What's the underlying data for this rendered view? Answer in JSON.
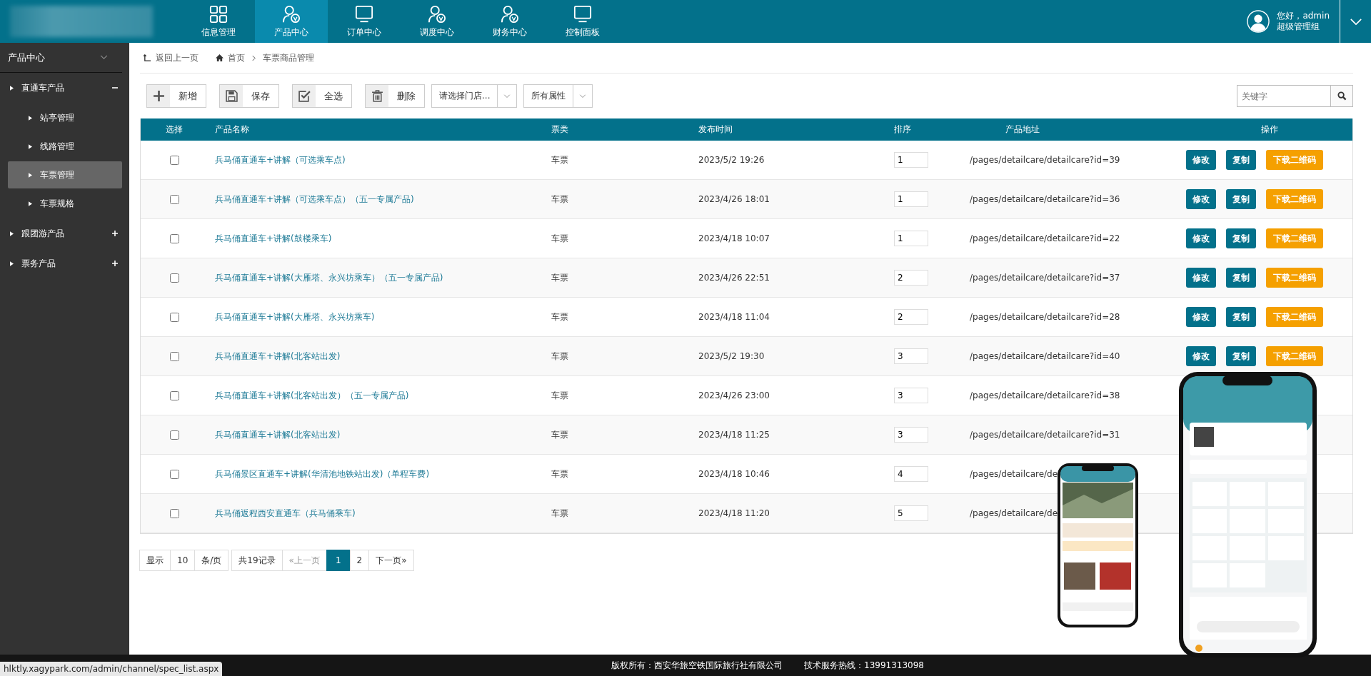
{
  "header": {
    "nav": [
      {
        "label": "信息管理",
        "selected": false
      },
      {
        "label": "产品中心",
        "selected": true
      },
      {
        "label": "订单中心",
        "selected": false
      },
      {
        "label": "调度中心",
        "selected": false
      },
      {
        "label": "财务中心",
        "selected": false
      },
      {
        "label": "控制面板",
        "selected": false
      }
    ],
    "user": {
      "greeting": "您好，admin",
      "role": "超级管理组"
    }
  },
  "sidebar": {
    "title": "产品中心",
    "groups": [
      {
        "label": "直通车产品",
        "expanded": true,
        "children": [
          {
            "label": "站亭管理",
            "selected": false
          },
          {
            "label": "线路管理",
            "selected": false
          },
          {
            "label": "车票管理",
            "selected": true
          },
          {
            "label": "车票规格",
            "selected": false
          }
        ]
      },
      {
        "label": "跟团游产品",
        "expanded": false
      },
      {
        "label": "票务产品",
        "expanded": false
      }
    ]
  },
  "breadcrumb": {
    "back": "返回上一页",
    "home": "首页",
    "current": "车票商品管理"
  },
  "toolbar": {
    "buttons": [
      "新增",
      "保存",
      "全选",
      "删除"
    ],
    "selects": [
      "请选择门店...",
      "所有属性"
    ],
    "search": {
      "placeholder": "关键字"
    }
  },
  "table": {
    "columns": [
      "选择",
      "产品名称",
      "票类",
      "发布时间",
      "排序",
      "产品地址",
      "操作"
    ],
    "rows": [
      {
        "checked": false,
        "name": "兵马俑直通车+讲解（可选乘车点)",
        "type": "车票",
        "time": "2023/5/2 19:26",
        "sort": "1",
        "url": "/pages/detailcare/detailcare?id=39",
        "actions": [
          "修改",
          "复制",
          "下载二维码"
        ]
      },
      {
        "checked": false,
        "name": "兵马俑直通车+讲解（可选乘车点）（五一专属产品)",
        "type": "车票",
        "time": "2023/4/26 18:01",
        "sort": "1",
        "url": "/pages/detailcare/detailcare?id=36",
        "actions": [
          "修改",
          "复制",
          "下载二维码"
        ]
      },
      {
        "checked": false,
        "name": "兵马俑直通车+讲解(鼓楼乘车)",
        "type": "车票",
        "time": "2023/4/18 10:07",
        "sort": "1",
        "url": "/pages/detailcare/detailcare?id=22",
        "actions": [
          "修改",
          "复制",
          "下载二维码"
        ]
      },
      {
        "checked": false,
        "name": "兵马俑直通车+讲解(大雁塔、永兴坊乘车）（五一专属产品)",
        "type": "车票",
        "time": "2023/4/26 22:51",
        "sort": "2",
        "url": "/pages/detailcare/detailcare?id=37",
        "actions": [
          "修改",
          "复制",
          "下载二维码"
        ]
      },
      {
        "checked": false,
        "name": "兵马俑直通车+讲解(大雁塔、永兴坊乘车)",
        "type": "车票",
        "time": "2023/4/18 11:04",
        "sort": "2",
        "url": "/pages/detailcare/detailcare?id=28",
        "actions": [
          "修改",
          "复制",
          "下载二维码"
        ]
      },
      {
        "checked": false,
        "name": "兵马俑直通车+讲解(北客站出发)",
        "type": "车票",
        "time": "2023/5/2 19:30",
        "sort": "3",
        "url": "/pages/detailcare/detailcare?id=40",
        "actions": [
          "修改",
          "复制",
          "下载二维码"
        ]
      },
      {
        "checked": false,
        "name": "兵马俑直通车+讲解(北客站出发）（五一专属产品)",
        "type": "车票",
        "time": "2023/4/26 23:00",
        "sort": "3",
        "url": "/pages/detailcare/detailcare?id=38"
      },
      {
        "checked": false,
        "name": "兵马俑直通车+讲解(北客站出发)",
        "type": "车票",
        "time": "2023/4/18 11:25",
        "sort": "3",
        "url": "/pages/detailcare/detailcare?id=31"
      },
      {
        "checked": false,
        "name": "兵马俑景区直通车+讲解(华清池地铁站出发)（单程车费)",
        "type": "车票",
        "time": "2023/4/18 10:46",
        "sort": "4",
        "url": "/pages/detailcare/de"
      },
      {
        "checked": false,
        "name": "兵马俑返程西安直通车（兵马俑乘车)",
        "type": "车票",
        "time": "2023/4/18 11:20",
        "sort": "5",
        "url": "/pages/detailcare/de"
      }
    ]
  },
  "pagination": {
    "show": "显示",
    "per_page": "10",
    "unit": "条/页",
    "total": "共19记录",
    "prev": "«上一页",
    "pages": [
      {
        "label": "1",
        "selected": true
      },
      {
        "label": "2",
        "selected": false
      }
    ],
    "next": "下一页»"
  },
  "footer": {
    "copyright": "版权所有：西安华旅空铁国际旅行社有限公司",
    "hotline": "技术服务热线：13991313098"
  },
  "status_url": "hlktly.xagypark.com/admin/channel/spec_list.aspx"
}
